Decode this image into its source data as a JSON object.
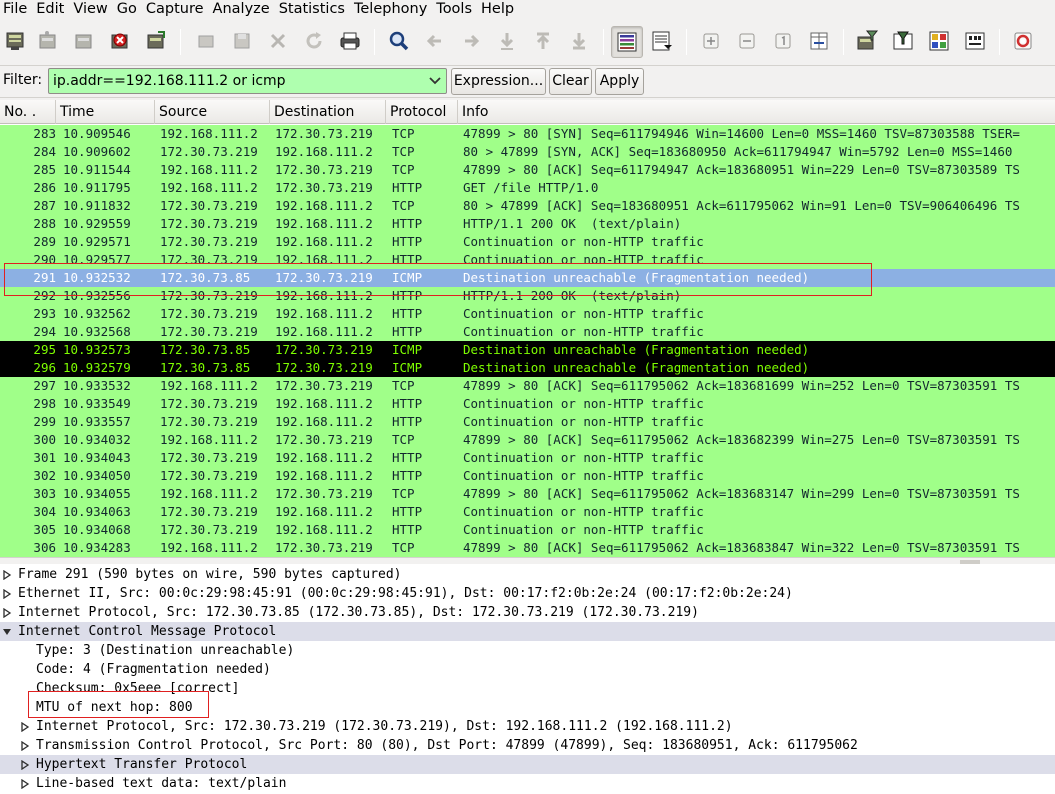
{
  "menu": [
    "File",
    "Edit",
    "View",
    "Go",
    "Capture",
    "Analyze",
    "Statistics",
    "Telephony",
    "Tools",
    "Help"
  ],
  "filter": {
    "label": "Filter:",
    "value": "ip.addr==192.168.111.2 or icmp",
    "expression_label": "Expression...",
    "clear_label": "Clear",
    "apply_label": "Apply"
  },
  "columns": [
    "No. .",
    "Time",
    "Source",
    "Destination",
    "Protocol",
    "Info"
  ],
  "packets": [
    {
      "no": "283",
      "time": "10.909546",
      "src": "192.168.111.2",
      "dst": "172.30.73.219",
      "proto": "TCP",
      "info": "47899 > 80 [SYN] Seq=611794946 Win=14600 Len=0 MSS=1460 TSV=87303588 TSER=",
      "style": "normal"
    },
    {
      "no": "284",
      "time": "10.909602",
      "src": "172.30.73.219",
      "dst": "192.168.111.2",
      "proto": "TCP",
      "info": "80 > 47899 [SYN, ACK] Seq=183680950 Ack=611794947 Win=5792 Len=0 MSS=1460",
      "style": "normal"
    },
    {
      "no": "285",
      "time": "10.911544",
      "src": "192.168.111.2",
      "dst": "172.30.73.219",
      "proto": "TCP",
      "info": "47899 > 80 [ACK] Seq=611794947 Ack=183680951 Win=229 Len=0 TSV=87303589 TS",
      "style": "normal"
    },
    {
      "no": "286",
      "time": "10.911795",
      "src": "192.168.111.2",
      "dst": "172.30.73.219",
      "proto": "HTTP",
      "info": "GET /file HTTP/1.0",
      "style": "normal"
    },
    {
      "no": "287",
      "time": "10.911832",
      "src": "172.30.73.219",
      "dst": "192.168.111.2",
      "proto": "TCP",
      "info": "80 > 47899 [ACK] Seq=183680951 Ack=611795062 Win=91 Len=0 TSV=906406496 TS",
      "style": "normal"
    },
    {
      "no": "288",
      "time": "10.929559",
      "src": "172.30.73.219",
      "dst": "192.168.111.2",
      "proto": "HTTP",
      "info": "HTTP/1.1 200 OK  (text/plain)",
      "style": "normal"
    },
    {
      "no": "289",
      "time": "10.929571",
      "src": "172.30.73.219",
      "dst": "192.168.111.2",
      "proto": "HTTP",
      "info": "Continuation or non-HTTP traffic",
      "style": "normal"
    },
    {
      "no": "290",
      "time": "10.929577",
      "src": "172.30.73.219",
      "dst": "192.168.111.2",
      "proto": "HTTP",
      "info": "Continuation or non-HTTP traffic",
      "style": "normal"
    },
    {
      "no": "291",
      "time": "10.932532",
      "src": "172.30.73.85",
      "dst": "172.30.73.219",
      "proto": "ICMP",
      "info": "Destination unreachable (Fragmentation needed)",
      "style": "selected"
    },
    {
      "no": "292",
      "time": "10.932556",
      "src": "172.30.73.219",
      "dst": "192.168.111.2",
      "proto": "HTTP",
      "info": "HTTP/1.1 200 OK  (text/plain)",
      "style": "normal"
    },
    {
      "no": "293",
      "time": "10.932562",
      "src": "172.30.73.219",
      "dst": "192.168.111.2",
      "proto": "HTTP",
      "info": "Continuation or non-HTTP traffic",
      "style": "normal"
    },
    {
      "no": "294",
      "time": "10.932568",
      "src": "172.30.73.219",
      "dst": "192.168.111.2",
      "proto": "HTTP",
      "info": "Continuation or non-HTTP traffic",
      "style": "normal"
    },
    {
      "no": "295",
      "time": "10.932573",
      "src": "172.30.73.85",
      "dst": "172.30.73.219",
      "proto": "ICMP",
      "info": "Destination unreachable (Fragmentation needed)",
      "style": "dark"
    },
    {
      "no": "296",
      "time": "10.932579",
      "src": "172.30.73.85",
      "dst": "172.30.73.219",
      "proto": "ICMP",
      "info": "Destination unreachable (Fragmentation needed)",
      "style": "dark"
    },
    {
      "no": "297",
      "time": "10.933532",
      "src": "192.168.111.2",
      "dst": "172.30.73.219",
      "proto": "TCP",
      "info": "47899 > 80 [ACK] Seq=611795062 Ack=183681699 Win=252 Len=0 TSV=87303591 TS",
      "style": "normal"
    },
    {
      "no": "298",
      "time": "10.933549",
      "src": "172.30.73.219",
      "dst": "192.168.111.2",
      "proto": "HTTP",
      "info": "Continuation or non-HTTP traffic",
      "style": "normal"
    },
    {
      "no": "299",
      "time": "10.933557",
      "src": "172.30.73.219",
      "dst": "192.168.111.2",
      "proto": "HTTP",
      "info": "Continuation or non-HTTP traffic",
      "style": "normal"
    },
    {
      "no": "300",
      "time": "10.934032",
      "src": "192.168.111.2",
      "dst": "172.30.73.219",
      "proto": "TCP",
      "info": "47899 > 80 [ACK] Seq=611795062 Ack=183682399 Win=275 Len=0 TSV=87303591 TS",
      "style": "normal"
    },
    {
      "no": "301",
      "time": "10.934043",
      "src": "172.30.73.219",
      "dst": "192.168.111.2",
      "proto": "HTTP",
      "info": "Continuation or non-HTTP traffic",
      "style": "normal"
    },
    {
      "no": "302",
      "time": "10.934050",
      "src": "172.30.73.219",
      "dst": "192.168.111.2",
      "proto": "HTTP",
      "info": "Continuation or non-HTTP traffic",
      "style": "normal"
    },
    {
      "no": "303",
      "time": "10.934055",
      "src": "192.168.111.2",
      "dst": "172.30.73.219",
      "proto": "TCP",
      "info": "47899 > 80 [ACK] Seq=611795062 Ack=183683147 Win=299 Len=0 TSV=87303591 TS",
      "style": "normal"
    },
    {
      "no": "304",
      "time": "10.934063",
      "src": "172.30.73.219",
      "dst": "192.168.111.2",
      "proto": "HTTP",
      "info": "Continuation or non-HTTP traffic",
      "style": "normal"
    },
    {
      "no": "305",
      "time": "10.934068",
      "src": "172.30.73.219",
      "dst": "192.168.111.2",
      "proto": "HTTP",
      "info": "Continuation or non-HTTP traffic",
      "style": "normal"
    },
    {
      "no": "306",
      "time": "10.934283",
      "src": "192.168.111.2",
      "dst": "172.30.73.219",
      "proto": "TCP",
      "info": "47899 > 80 [ACK] Seq=611795062 Ack=183683847 Win=322 Len=0 TSV=87303591 TS",
      "style": "normal"
    }
  ],
  "details": [
    {
      "text": "Frame 291 (590 bytes on wire, 590 bytes captured)",
      "level": 0,
      "expander": "collapsed",
      "hl": false
    },
    {
      "text": "Ethernet II, Src: 00:0c:29:98:45:91 (00:0c:29:98:45:91), Dst: 00:17:f2:0b:2e:24 (00:17:f2:0b:2e:24)",
      "level": 0,
      "expander": "collapsed",
      "hl": false
    },
    {
      "text": "Internet Protocol, Src: 172.30.73.85 (172.30.73.85), Dst: 172.30.73.219 (172.30.73.219)",
      "level": 0,
      "expander": "collapsed",
      "hl": false
    },
    {
      "text": "Internet Control Message Protocol",
      "level": 0,
      "expander": "expanded",
      "hl": true
    },
    {
      "text": "Type: 3 (Destination unreachable)",
      "level": 1,
      "expander": "none",
      "hl": false
    },
    {
      "text": "Code: 4 (Fragmentation needed)",
      "level": 1,
      "expander": "none",
      "hl": false
    },
    {
      "text": "Checksum: 0x5eee [correct]",
      "level": 1,
      "expander": "none",
      "hl": false
    },
    {
      "text": "MTU of next hop: 800",
      "level": 1,
      "expander": "none",
      "hl": false
    },
    {
      "text": "Internet Protocol, Src: 172.30.73.219 (172.30.73.219), Dst: 192.168.111.2 (192.168.111.2)",
      "level": 1,
      "expander": "collapsed",
      "hl": false
    },
    {
      "text": "Transmission Control Protocol, Src Port: 80 (80), Dst Port: 47899 (47899), Seq: 183680951, Ack: 611795062",
      "level": 1,
      "expander": "collapsed",
      "hl": false
    },
    {
      "text": "Hypertext Transfer Protocol",
      "level": 1,
      "expander": "collapsed",
      "hl": true
    },
    {
      "text": "Line-based text data: text/plain",
      "level": 1,
      "expander": "collapsed",
      "hl": false
    }
  ],
  "colors": {
    "row_green": "#a0ff89",
    "row_selected": "#8cb0e3",
    "row_dark_bg": "#000000",
    "row_dark_fg": "#7fff00",
    "filter_valid": "#afffaf",
    "annotation_red": "#e02020"
  },
  "toolbar_icons": [
    "interface-list-icon",
    "capture-options-icon",
    "start-capture-icon",
    "stop-capture-icon",
    "restart-capture-icon",
    "open-file-icon",
    "save-file-icon",
    "close-file-icon",
    "reload-icon",
    "print-icon",
    "find-packet-icon",
    "go-back-icon",
    "go-forward-icon",
    "go-to-packet-icon",
    "go-first-icon",
    "go-last-icon",
    "colorize-icon",
    "auto-scroll-icon",
    "zoom-in-icon",
    "zoom-out-icon",
    "normal-size-icon",
    "resize-columns-icon",
    "capture-filters-icon",
    "display-filters-icon",
    "coloring-rules-icon",
    "preferences-icon",
    "help-icon"
  ]
}
